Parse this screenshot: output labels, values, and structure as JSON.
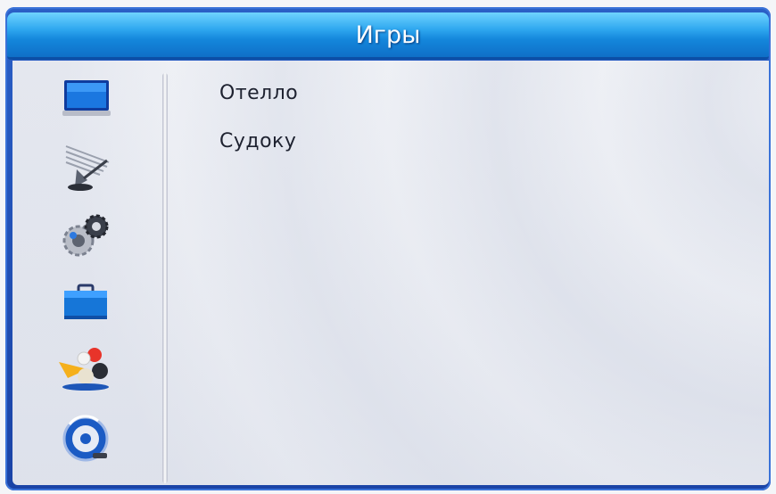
{
  "header": {
    "title": "Игры"
  },
  "sidebar": {
    "icons": [
      {
        "name": "tv-monitor-icon"
      },
      {
        "name": "satellite-dish-icon"
      },
      {
        "name": "settings-gears-icon"
      },
      {
        "name": "toolbox-icon"
      },
      {
        "name": "games-icon"
      },
      {
        "name": "media-player-icon"
      }
    ]
  },
  "menu": {
    "items": [
      "Отелло",
      "Судоку"
    ]
  },
  "colors": {
    "title_bar": "#1f96e6",
    "frame": "#1a43a6",
    "background": "#eef0f5",
    "text": "#1e2230"
  }
}
